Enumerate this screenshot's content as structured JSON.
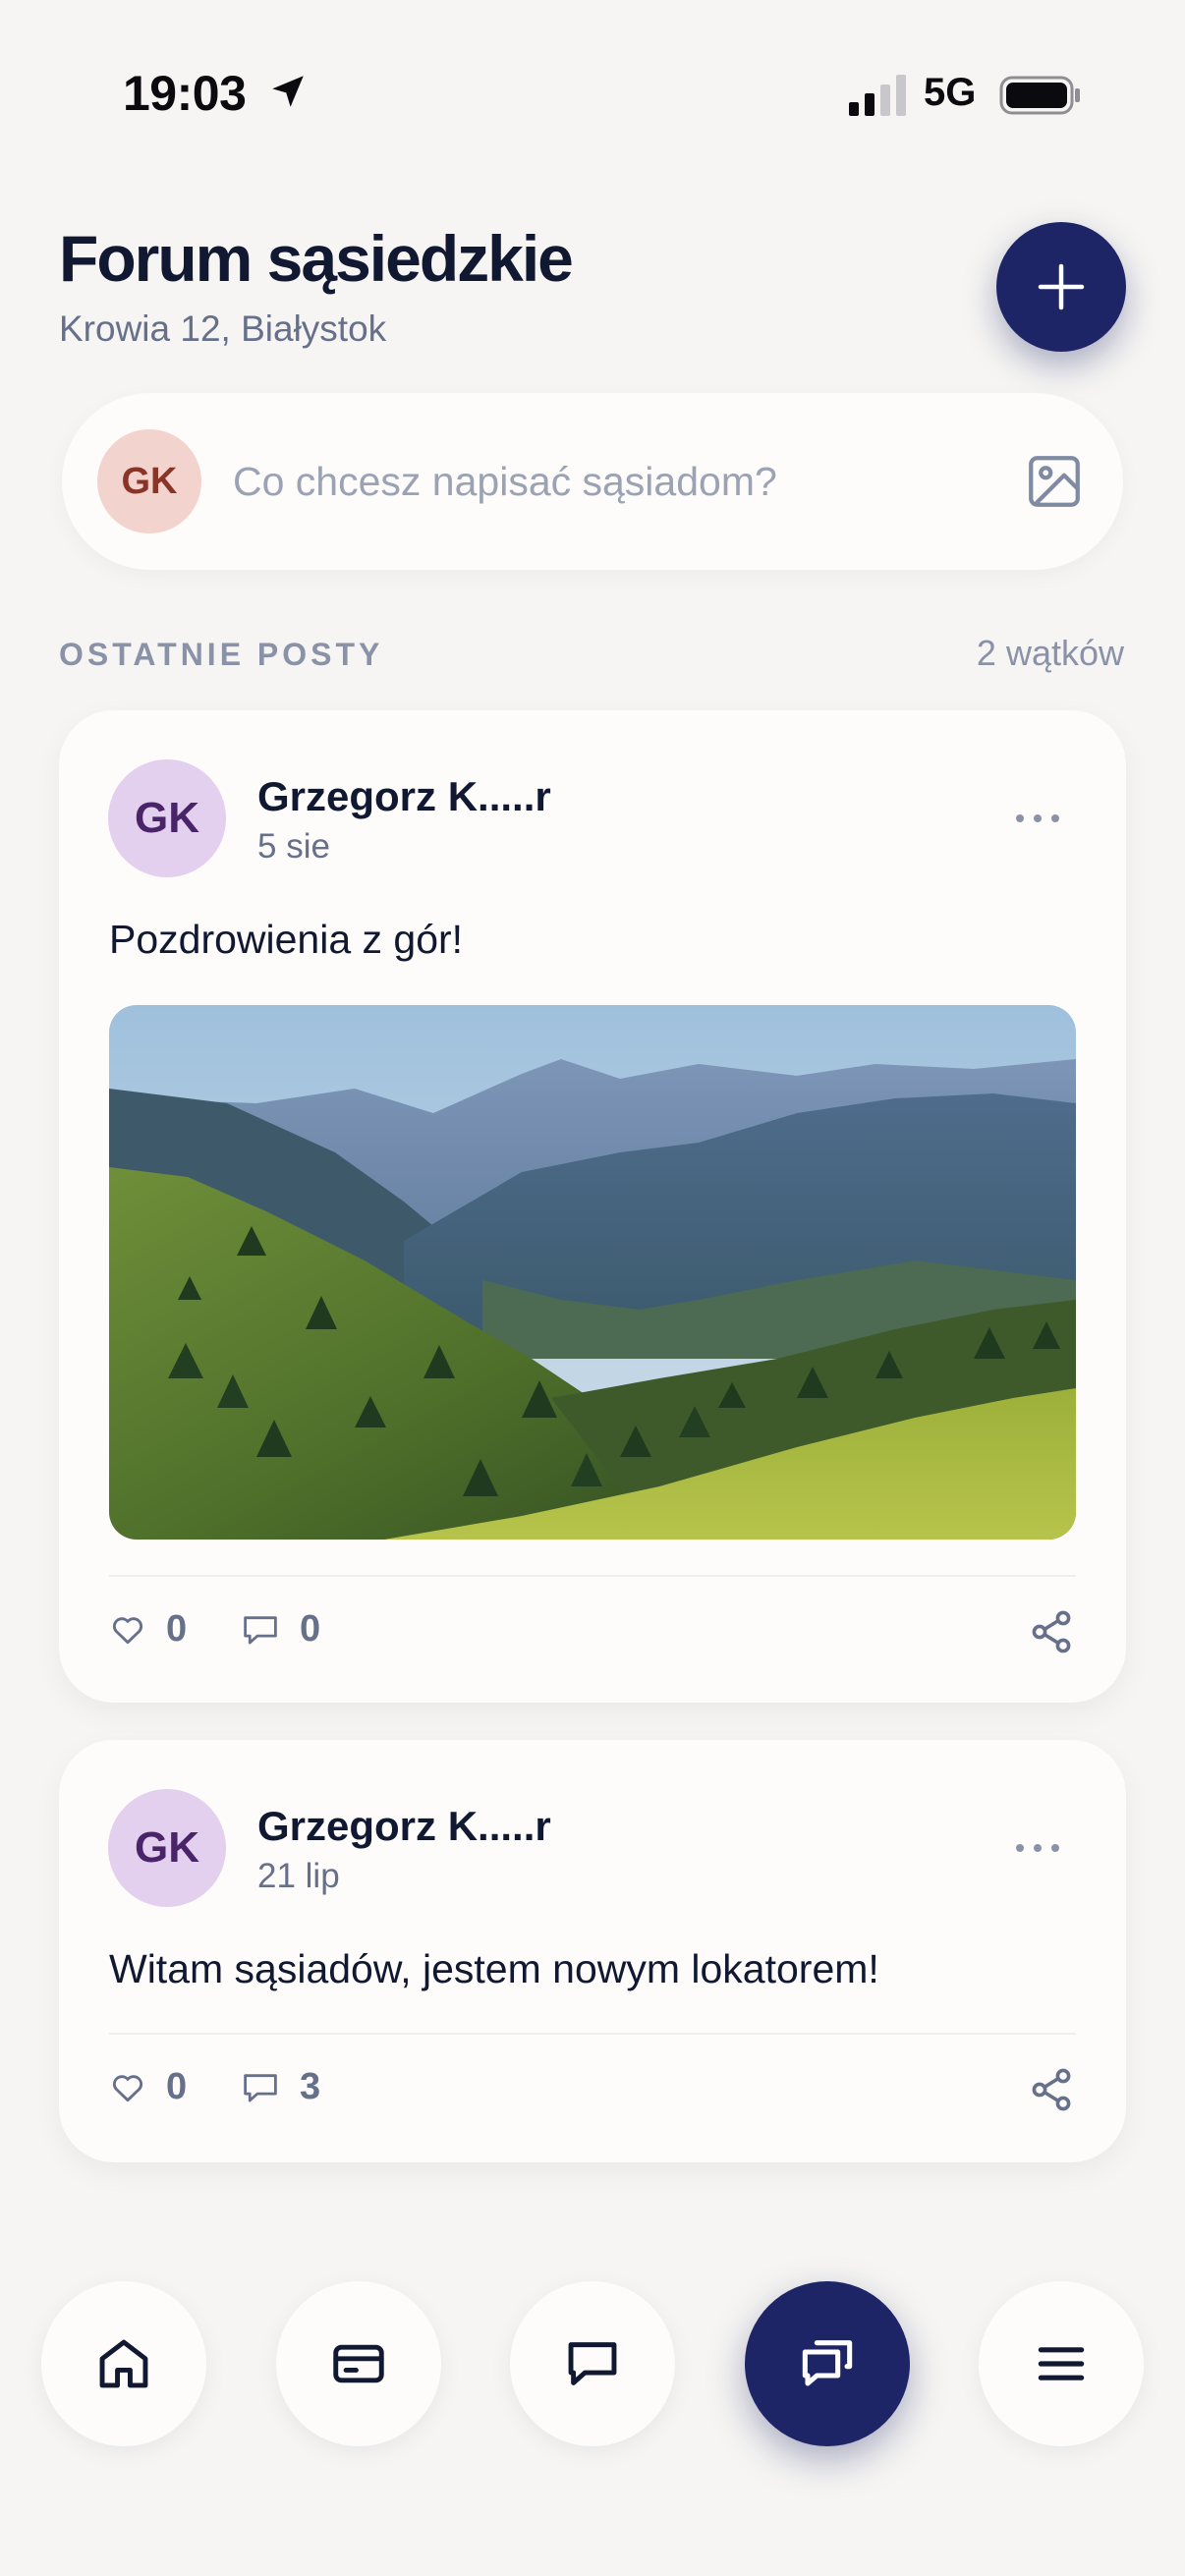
{
  "status_bar": {
    "time": "19:03",
    "network": "5G"
  },
  "header": {
    "title": "Forum sąsiedzkie",
    "subtitle": "Krowia 12, Białystok"
  },
  "composer": {
    "avatar_initials": "GK",
    "placeholder": "Co chcesz napisać sąsiadom?"
  },
  "section": {
    "label": "OSTATNIE POSTY",
    "count": "2 wątków"
  },
  "posts": [
    {
      "initials": "GK",
      "author": "Grzegorz K.....r",
      "date": "5 sie",
      "text": "Pozdrowienia z gór!",
      "likes": "0",
      "comments": "0",
      "has_photo": true
    },
    {
      "initials": "GK",
      "author": "Grzegorz K.....r",
      "date": "21 lip",
      "text": "Witam sąsiadów, jestem nowym lokatorem!",
      "likes": "0",
      "comments": "3",
      "has_photo": false
    }
  ],
  "nav": [
    {
      "icon": "home-icon",
      "active": false
    },
    {
      "icon": "card-icon",
      "active": false
    },
    {
      "icon": "chat-icon",
      "active": false
    },
    {
      "icon": "forum-icon",
      "active": true
    },
    {
      "icon": "menu-icon",
      "active": false
    }
  ],
  "colors": {
    "accent": "#1d2566",
    "background": "#f6f5f3",
    "card": "#fdfcfa",
    "muted": "#66708a"
  }
}
